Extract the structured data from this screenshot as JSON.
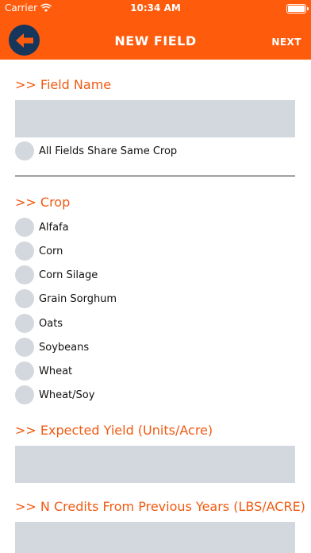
{
  "status_bar": {
    "carrier": "Carrier",
    "time": "10:34 AM",
    "battery_level": 1.0
  },
  "nav": {
    "title": "NEW FIELD",
    "next_label": "NEXT",
    "back_icon": "arrow-left-icon"
  },
  "field_name": {
    "header": ">> Field Name",
    "value": "",
    "share_label": "All Fields Share Same Crop"
  },
  "crop": {
    "header": ">> Crop",
    "options": [
      "Alfafa",
      "Corn",
      "Corn Silage",
      "Grain Sorghum",
      "Oats",
      "Soybeans",
      "Wheat",
      "Wheat/Soy"
    ]
  },
  "expected_yield": {
    "header": ">> Expected Yield (Units/Acre)",
    "value": ""
  },
  "n_credits": {
    "header": ">> N Credits From Previous Years (LBS/ACRE)",
    "value": ""
  },
  "colors": {
    "brand_orange": "#ff5b0c",
    "header_orange": "#f05a12",
    "navy": "#16365c",
    "input_gray": "#d3d8df"
  }
}
